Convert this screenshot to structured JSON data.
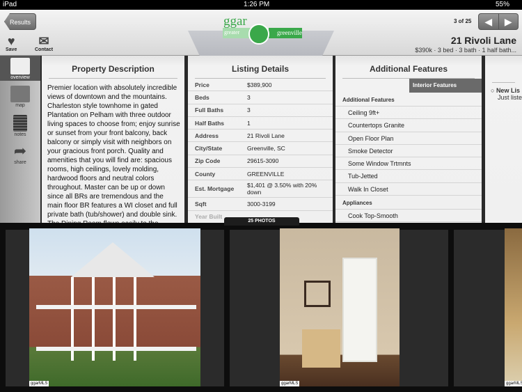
{
  "status": {
    "device": "iPad",
    "time": "1:26 PM",
    "battery": "55%"
  },
  "header": {
    "back": "Results",
    "logo": {
      "top": "ggar",
      "left": "greater",
      "right": "greenville"
    },
    "counter": "3 of 25",
    "prev_icon": "chevron-left-icon",
    "next_icon": "chevron-right-icon",
    "save": "Save",
    "contact": "Contact",
    "title": "21 Rivoli Lane",
    "subtitle": "$390k  ·  3 bed  ·  3 bath  ·  1 half bath..."
  },
  "sidebar": {
    "items": [
      {
        "label": "overview",
        "icon": "overview-icon"
      },
      {
        "label": "map",
        "icon": "map-icon"
      },
      {
        "label": "notes",
        "icon": "notes-icon"
      },
      {
        "label": "share",
        "icon": "share-icon"
      }
    ]
  },
  "description": {
    "title": "Property Description",
    "text": "Premier location with absolutely incredible views of downtown and the mountains. Charleston style townhome in gated Plantation on Pelham with three outdoor living spaces to choose from; enjoy sunrise or sunset from your front balcony, back balcony or simply visit with neighbors on your gracious front porch. Quality and amenities that you will find are: spacious rooms, high ceilings, lovely molding, hardwood floors and neutral colors throughout. Master can be up or down since all BRs are tremendous and the main floor BR features a WI closet and full private bath (tub/shower) and double sink. The Dining Room flows easily to the granite kitchen which boasts miles of"
  },
  "details": {
    "title": "Listing Details",
    "rows": [
      {
        "k": "Price",
        "v": "$389,900"
      },
      {
        "k": "Beds",
        "v": "3"
      },
      {
        "k": "Full Baths",
        "v": "3"
      },
      {
        "k": "Half Baths",
        "v": "1"
      },
      {
        "k": "Address",
        "v": "21 Rivoli Lane"
      },
      {
        "k": "City/State",
        "v": "Greenville, SC"
      },
      {
        "k": "Zip Code",
        "v": "29615-3090"
      },
      {
        "k": "County",
        "v": "GREENVILLE"
      },
      {
        "k": "Est. Mortgage",
        "v": "$1,401 @ 3.50% with 20% down"
      },
      {
        "k": "Sqft",
        "v": "3000-3199"
      },
      {
        "k": "Year Built",
        "v": ""
      }
    ]
  },
  "features": {
    "title": "Additional Features",
    "tab": "Interior Features",
    "head1": "Additional Features",
    "items": [
      "Ceiling 9ft+",
      "Countertops Granite",
      "Open Floor Plan",
      "Smoke Detector",
      "Some Window Trtmnts",
      "Tub-Jetted",
      "Walk In Closet"
    ],
    "head2": "Appliances",
    "items2": [
      "Cook Top-Smooth"
    ]
  },
  "next_panel": {
    "line1": "New Lis",
    "line2": "Just liste"
  },
  "photos": {
    "label": "25 PHOTOS",
    "watermark": "ggarMLS"
  }
}
